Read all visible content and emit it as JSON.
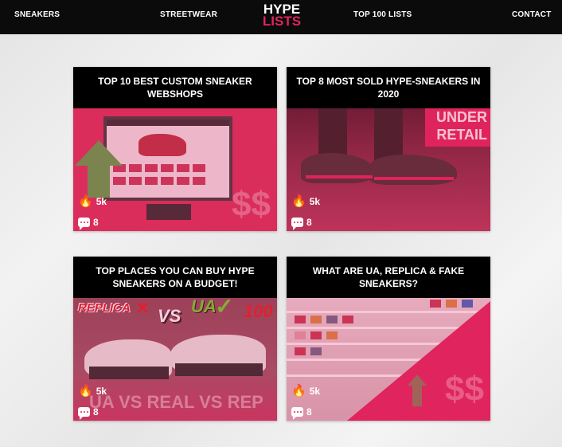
{
  "nav": {
    "left": [
      "SNEAKERS",
      "STREETWEAR"
    ],
    "right": [
      "TOP 100 LISTS",
      "CONTACT"
    ],
    "logo_top": "HYPE",
    "logo_bottom": "LISTS",
    "logo_accent": "#e0245e"
  },
  "cards": [
    {
      "title": "TOP 10 BEST CUSTOM SNEAKER WEBSHOPS",
      "likes": "5k",
      "comments": "8",
      "image_text": "$$"
    },
    {
      "title": "TOP 8 MOST SOLD HYPE-SNEAKERS IN 2020",
      "likes": "5k",
      "comments": "8",
      "image_text": "UNDER RETAIL"
    },
    {
      "title": "TOP PLACES YOU CAN BUY HYPE SNEAKERS ON A BUDGET!",
      "likes": "5k",
      "comments": "8",
      "image_text": "UA VS REAL VS REP",
      "image_labels": [
        "REPLICA",
        "VS",
        "UA",
        "100"
      ]
    },
    {
      "title": "WHAT ARE UA, REPLICA & FAKE SNEAKERS?",
      "likes": "5k",
      "comments": "8",
      "image_text": "$$"
    }
  ],
  "icons": {
    "likes": "fire-icon",
    "comments": "comment-icon"
  },
  "colors": {
    "accent": "#e0245e",
    "nav_bg": "#0b0b0b",
    "card_header_bg": "#000000"
  }
}
